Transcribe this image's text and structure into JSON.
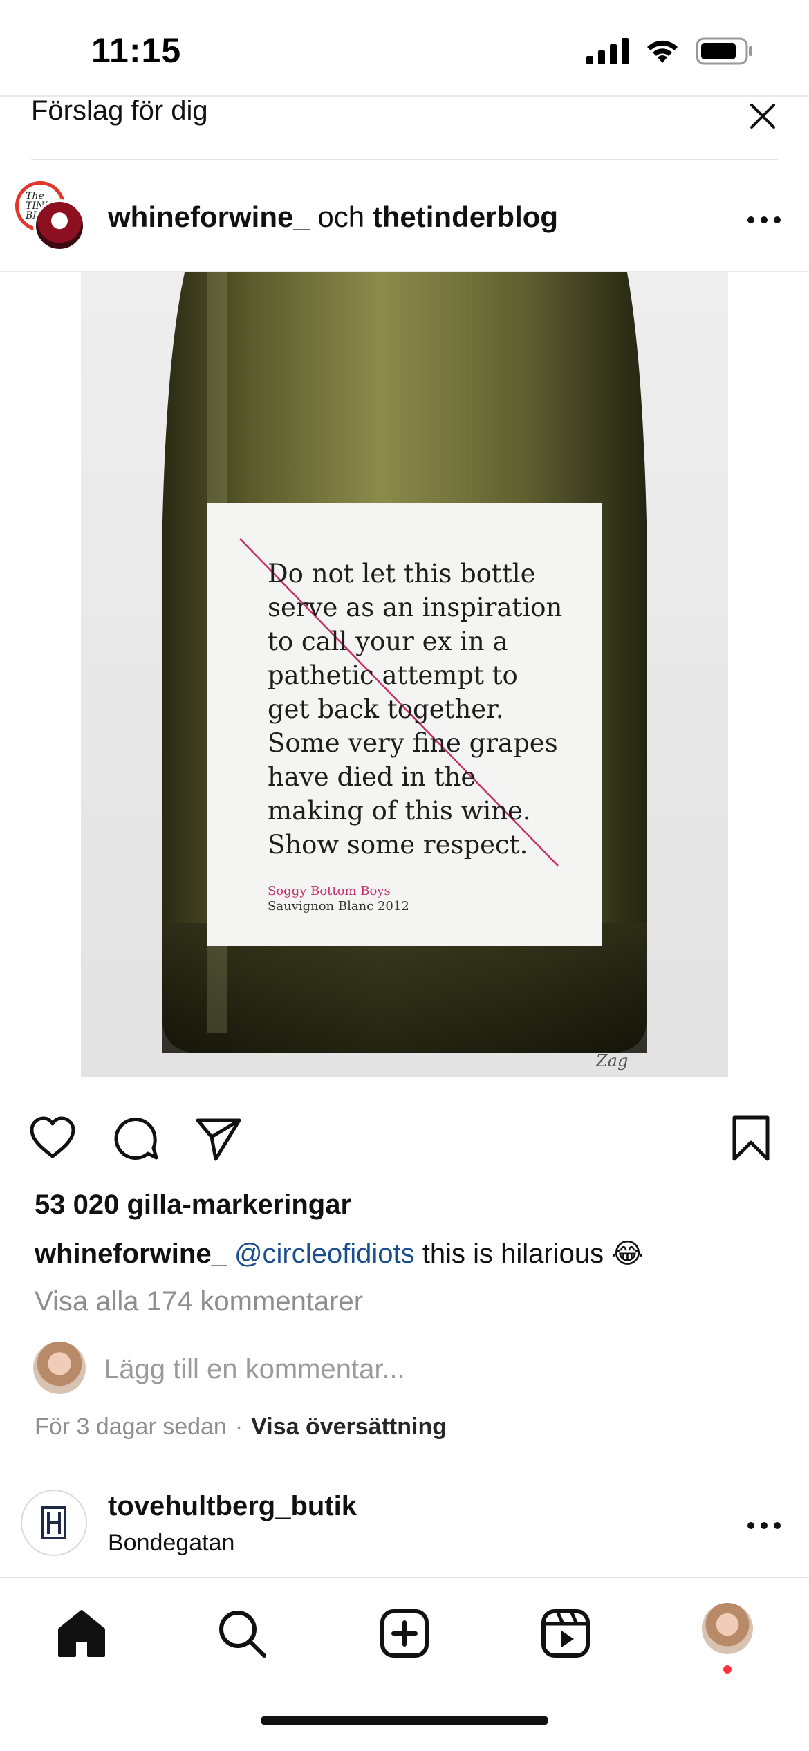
{
  "status": {
    "time": "11:15"
  },
  "suggested": {
    "title": "Förslag för dig"
  },
  "post": {
    "user1": "whineforwine_",
    "connector": " och ",
    "user2": "thetinderblog",
    "avatar_back_text": "The TINDER BL",
    "image": {
      "label_lines": [
        "Do not let this bottle",
        "serve as an inspiration",
        "to call your ex in a",
        "pathetic attempt to",
        "get back together.",
        "Some very fine grapes",
        "have died in the",
        "making of this wine.",
        "Show some respect."
      ],
      "brand": "Soggy Bottom Boys",
      "variety": "Sauvignon Blanc 2012",
      "signature": "Zag"
    },
    "likes": "53 020 gilla-markeringar",
    "caption_user": "whineforwine_",
    "caption_mention": "@circleofidiots",
    "caption_text": " this is hilarious 😂",
    "view_comments": "Visa alla 174 kommentarer",
    "comment_placeholder": "Lägg till en kommentar...",
    "time_ago": "För 3 dagar sedan",
    "separator": "·",
    "translate": "Visa översättning"
  },
  "next_post": {
    "user": "tovehultberg_butik",
    "location": "Bondegatan"
  },
  "icons": {
    "close": "close-icon",
    "more": "more-icon",
    "like": "heart-icon",
    "comment": "comment-icon",
    "share": "send-icon",
    "save": "bookmark-icon",
    "home": "home-icon",
    "search": "search-icon",
    "create": "plus-square-icon",
    "reels": "reels-icon"
  },
  "colors": {
    "mention": "#1b4e8c",
    "notification_dot": "#ff3040",
    "label_brand": "#c4306b"
  }
}
